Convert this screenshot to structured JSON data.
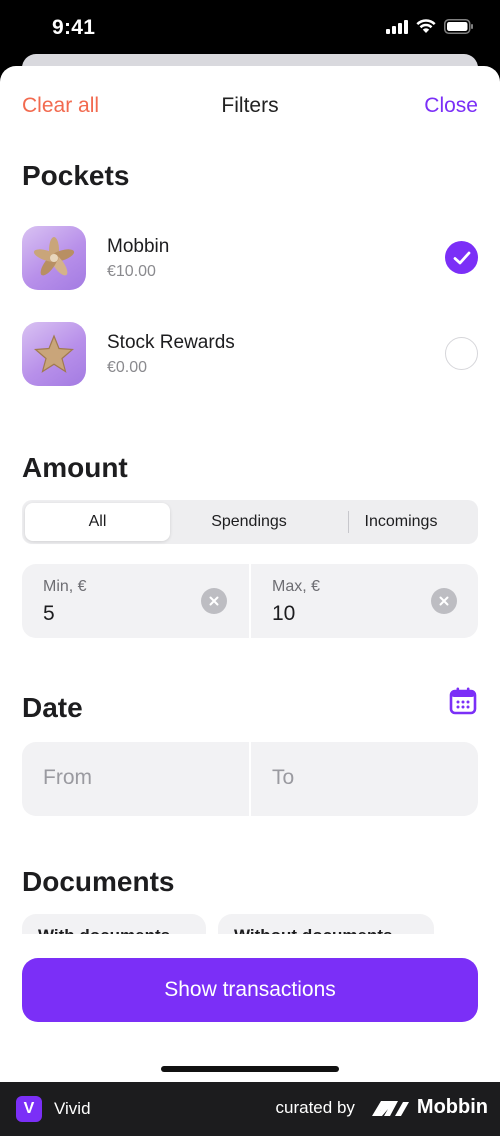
{
  "status_bar": {
    "time": "9:41"
  },
  "nav": {
    "clear_all": "Clear all",
    "title": "Filters",
    "close": "Close"
  },
  "pockets": {
    "title": "Pockets",
    "items": [
      {
        "name": "Mobbin",
        "amount": "€10.00",
        "selected": true,
        "icon": "flower-icon"
      },
      {
        "name": "Stock Rewards",
        "amount": "€0.00",
        "selected": false,
        "icon": "star-icon"
      }
    ]
  },
  "amount": {
    "title": "Amount",
    "tabs": [
      {
        "label": "All",
        "active": true
      },
      {
        "label": "Spendings",
        "active": false
      },
      {
        "label": "Incomings",
        "active": false
      }
    ],
    "min": {
      "label": "Min, €",
      "value": "5"
    },
    "max": {
      "label": "Max, €",
      "value": "10"
    }
  },
  "date": {
    "title": "Date",
    "from_placeholder": "From",
    "to_placeholder": "To"
  },
  "documents": {
    "title": "Documents",
    "chips": [
      "With documents",
      "Without documents"
    ]
  },
  "primary_button": "Show transactions",
  "footer": {
    "brand_letter": "V",
    "brand_name": "Vivid",
    "curated_by": "curated by",
    "mobbin": "Mobbin"
  },
  "colors": {
    "accent": "#7b2ff7",
    "destructive": "#f26a4f"
  }
}
